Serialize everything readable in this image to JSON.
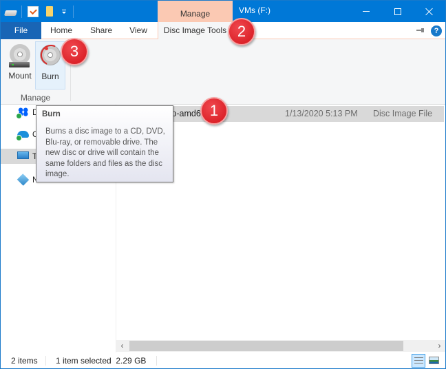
{
  "window": {
    "title": "VMs (F:)",
    "context_tab_header": "Manage",
    "controls": {
      "minimize": "minimize-icon",
      "maximize": "maximize-icon",
      "close": "close-icon"
    }
  },
  "quick_access_toolbar": {
    "icons": [
      "drive-icon",
      "properties-icon",
      "new-folder-icon",
      "customize-dropdown-icon"
    ]
  },
  "ribbon": {
    "tabs": [
      {
        "label": "File"
      },
      {
        "label": "Home"
      },
      {
        "label": "Share"
      },
      {
        "label": "View"
      },
      {
        "label": "Disc Image Tools",
        "active": true
      }
    ],
    "buttons": [
      {
        "label": "Mount",
        "icon": "mount-disc-icon"
      },
      {
        "label": "Burn",
        "icon": "burn-disc-icon",
        "hovered": true
      }
    ],
    "group_label": "Manage",
    "help": "?"
  },
  "tooltip": {
    "title": "Burn",
    "body": "Burns a disc image to a CD, DVD, Blu-ray, or removable drive. The new disc or drive will contain the same folders and files as the disc image."
  },
  "nav_pane": {
    "items": [
      {
        "label": "D",
        "icon": "dropbox-icon"
      },
      {
        "label": "O",
        "icon": "onedrive-icon"
      },
      {
        "label": "T",
        "icon": "this-pc-icon",
        "selected": true
      },
      {
        "label": "Network",
        "icon": "network-icon"
      }
    ]
  },
  "files": [
    {
      "name": "-19.10-desktop-amd64.iso",
      "date_modified": "1/13/2020 5:13 PM",
      "type": "Disc Image File",
      "selected": true
    }
  ],
  "status_bar": {
    "item_count": "2 items",
    "selection": "1 item selected  2.29 GB",
    "views": [
      "details-view-icon",
      "large-icons-view-icon"
    ]
  },
  "callouts": [
    "1",
    "2",
    "3"
  ],
  "colors": {
    "titlebar": "#0078d7",
    "file_tab": "#1965b5",
    "context_tab": "#fbc9b3",
    "selection": "#d9d9d9",
    "callout": "#d4141b"
  }
}
